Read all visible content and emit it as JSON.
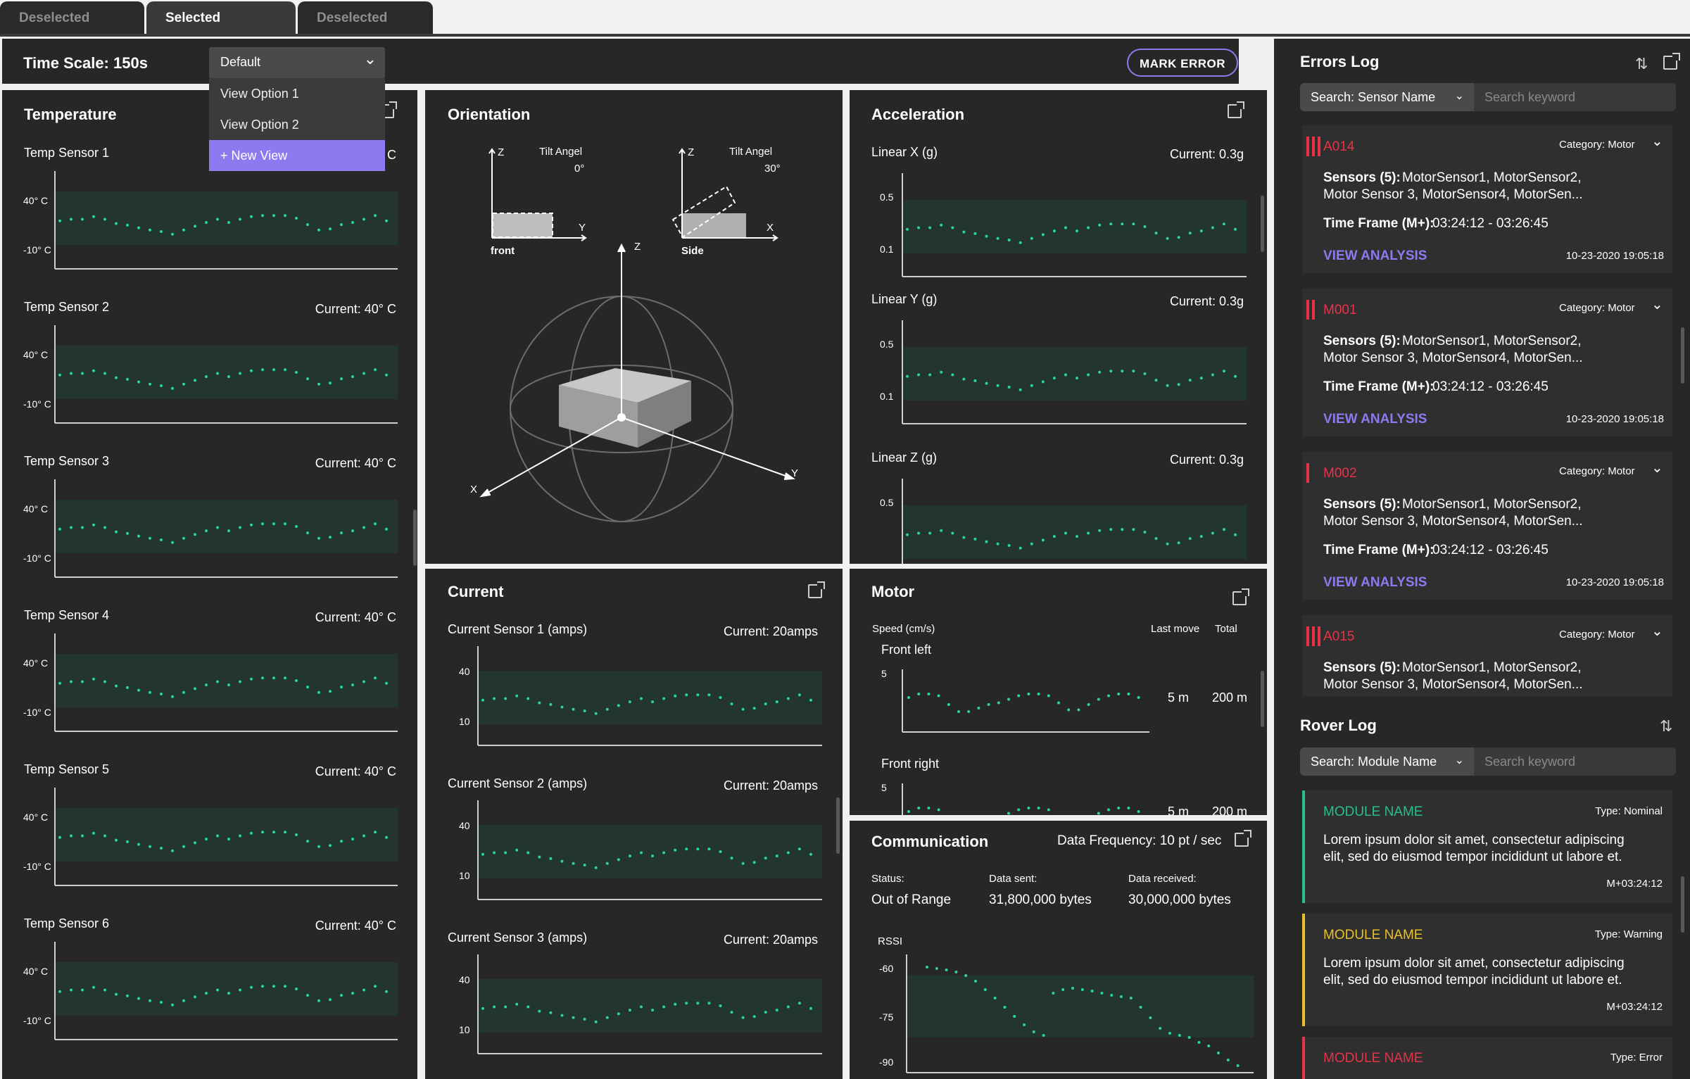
{
  "tabs": [
    {
      "label": "Deselected"
    },
    {
      "label": "Selected"
    },
    {
      "label": "Deselected"
    }
  ],
  "header": {
    "time_scale": "Time Scale: 150s",
    "mark_error": "MARK ERROR"
  },
  "view_dropdown": {
    "selected": "Default",
    "options": [
      "View Option 1",
      "View Option 2",
      "+ New View"
    ]
  },
  "temperature": {
    "title": "Temperature",
    "sensors": [
      {
        "name": "Temp Sensor 1",
        "current": "C",
        "ymax": "40° C",
        "ymin": "-10° C"
      },
      {
        "name": "Temp Sensor 2",
        "current": "Current: 40° C",
        "ymax": "40° C",
        "ymin": "-10° C"
      },
      {
        "name": "Temp Sensor 3",
        "current": "Current: 40° C",
        "ymax": "40° C",
        "ymin": "-10° C"
      },
      {
        "name": "Temp Sensor 4",
        "current": "Current: 40° C",
        "ymax": "40° C",
        "ymin": "-10° C"
      },
      {
        "name": "Temp Sensor 5",
        "current": "Current: 40° C",
        "ymax": "40° C",
        "ymin": "-10° C"
      },
      {
        "name": "Temp Sensor 6",
        "current": "Current: 40° C",
        "ymax": "40° C",
        "ymin": "-10° C"
      }
    ]
  },
  "orientation": {
    "title": "Orientation",
    "front": {
      "tilt_label": "Tilt Angel",
      "tilt_value": "0°",
      "caption": "front",
      "axis_v": "Z",
      "axis_h": "Y"
    },
    "side": {
      "tilt_label": "Tilt Angel",
      "tilt_value": "30°",
      "caption": "Side",
      "axis_v": "Z",
      "axis_h": "X"
    },
    "axes3d": {
      "z": "Z",
      "x": "X",
      "y": "Y"
    }
  },
  "acceleration": {
    "title": "Acceleration",
    "sensors": [
      {
        "name": "Linear X (g)",
        "current": "Current: 0.3g",
        "ymax": "0.5",
        "ymin": "0.1"
      },
      {
        "name": "Linear Y (g)",
        "current": "Current: 0.3g",
        "ymax": "0.5",
        "ymin": "0.1"
      },
      {
        "name": "Linear Z (g)",
        "current": "Current: 0.3g",
        "ymax": "0.5",
        "ymin": ""
      }
    ]
  },
  "current_panel": {
    "title": "Current",
    "sensors": [
      {
        "name": "Current Sensor 1 (amps)",
        "current": "Current: 20amps",
        "ymax": "40",
        "ymin": "10"
      },
      {
        "name": "Current Sensor 2 (amps)",
        "current": "Current: 20amps",
        "ymax": "40",
        "ymin": "10"
      },
      {
        "name": "Current Sensor 3 (amps)",
        "current": "Current: 20amps",
        "ymax": "40",
        "ymin": "10"
      }
    ]
  },
  "motor": {
    "title": "Motor",
    "speed_label": "Speed (cm/s)",
    "col_last": "Last move",
    "col_total": "Total",
    "rows": [
      {
        "name": "Front left",
        "ymax": "5",
        "last": "5 m",
        "total": "200 m"
      },
      {
        "name": "Front right",
        "ymax": "5",
        "last": "5 m",
        "total": "200 m"
      }
    ]
  },
  "communication": {
    "title": "Communication",
    "frequency": "Data Frequency: 10 pt / sec",
    "status_label": "Status:",
    "status_value": "Out of Range",
    "sent_label": "Data sent:",
    "sent_value": "31,800,000 bytes",
    "recv_label": "Data received:",
    "recv_value": "30,000,000 bytes",
    "rssi_label": "RSSI",
    "ticks": [
      "-60",
      "-75",
      "-90"
    ]
  },
  "errors_log": {
    "title": "Errors Log",
    "search_filter": "Search: Sensor Name",
    "search_placeholder": "Search keyword",
    "entries": [
      {
        "code": "A014",
        "category": "Category: Motor",
        "sensors_label": "Sensors (5):",
        "sensors_line1": "MotorSensor1, MotorSensor2,",
        "sensors_line2": "Motor Sensor 3, MotorSensor4, MotorSen...",
        "time_label": "Time Frame (M+):",
        "time_value": "03:24:12 - 03:26:45",
        "action": "VIEW ANALYSIS",
        "timestamp": "10-23-2020 19:05:18",
        "severity": 3
      },
      {
        "code": "M001",
        "category": "Category: Motor",
        "sensors_label": "Sensors (5):",
        "sensors_line1": "MotorSensor1, MotorSensor2,",
        "sensors_line2": "Motor Sensor 3, MotorSensor4, MotorSen...",
        "time_label": "Time Frame (M+):",
        "time_value": "03:24:12 - 03:26:45",
        "action": "VIEW ANALYSIS",
        "timestamp": "10-23-2020 19:05:18",
        "severity": 2
      },
      {
        "code": "M002",
        "category": "Category: Motor",
        "sensors_label": "Sensors (5):",
        "sensors_line1": "MotorSensor1, MotorSensor2,",
        "sensors_line2": "Motor Sensor 3, MotorSensor4, MotorSen...",
        "time_label": "Time Frame (M+):",
        "time_value": "03:24:12 - 03:26:45",
        "action": "VIEW ANALYSIS",
        "timestamp": "10-23-2020 19:05:18",
        "severity": 1
      },
      {
        "code": "A015",
        "category": "Category: Motor",
        "sensors_label": "Sensors (5):",
        "sensors_line1": "MotorSensor1, MotorSensor2,",
        "sensors_line2": "Motor Sensor 3, MotorSensor4, MotorSen...",
        "severity": 3
      }
    ]
  },
  "rover_log": {
    "title": "Rover Log",
    "search_filter": "Search: Module Name",
    "search_placeholder": "Search keyword",
    "entries": [
      {
        "name": "MODULE NAME",
        "type": "Type: Nominal",
        "line1": "Lorem ipsum dolor sit amet, consectetur adipiscing",
        "line2": "elit, sed do eiusmod tempor incididunt ut labore et.",
        "time": "M+03:24:12",
        "color": "#27c08a"
      },
      {
        "name": "MODULE NAME",
        "type": "Type: Warning",
        "line1": "Lorem ipsum dolor sit amet, consectetur adipiscing",
        "line2": "elit, sed do eiusmod tempor incididunt ut labore et.",
        "time": "M+03:24:12",
        "color": "#e8c02a"
      },
      {
        "name": "MODULE NAME",
        "type": "Type: Error",
        "color": "#e8324a"
      }
    ]
  },
  "colors": {
    "accent": "#8c7bf0",
    "dot": "#29d3a4",
    "error": "#e8324a",
    "band": "#23352f"
  }
}
